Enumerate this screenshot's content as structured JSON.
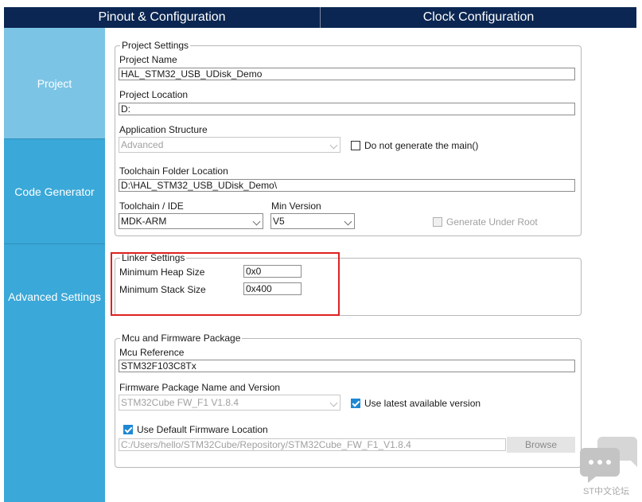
{
  "top_tabs": [
    "Pinout & Configuration",
    "Clock Configuration"
  ],
  "sidebar": {
    "items": [
      {
        "label": "Project",
        "active": true
      },
      {
        "label": "Code Generator",
        "active": false
      },
      {
        "label": "Advanced Settings",
        "active": false
      }
    ]
  },
  "project_settings": {
    "legend": "Project Settings",
    "project_name_label": "Project Name",
    "project_name_value": "HAL_STM32_USB_UDisk_Demo",
    "project_location_label": "Project Location",
    "project_location_value": "D:",
    "app_structure_label": "Application Structure",
    "app_structure_value": "Advanced",
    "no_main_label": "Do not generate the main()",
    "no_main_checked": false,
    "toolchain_folder_label": "Toolchain Folder Location",
    "toolchain_folder_value": "D:\\HAL_STM32_USB_UDisk_Demo\\",
    "toolchain_label": "Toolchain / IDE",
    "toolchain_value": "MDK-ARM",
    "min_version_label": "Min Version",
    "min_version_value": "V5",
    "gen_under_root_label": "Generate Under Root",
    "gen_under_root_checked": false
  },
  "linker_settings": {
    "legend": "Linker Settings",
    "heap_label": "Minimum Heap Size",
    "heap_value": "0x0",
    "stack_label": "Minimum Stack Size",
    "stack_value": "0x400"
  },
  "mcu_package": {
    "legend": "Mcu and Firmware Package",
    "mcu_ref_label": "Mcu Reference",
    "mcu_ref_value": "STM32F103C8Tx",
    "fw_pkg_label": "Firmware Package Name and Version",
    "fw_pkg_value": "STM32Cube FW_F1 V1.8.4",
    "use_latest_label": "Use latest available version",
    "use_latest_checked": true,
    "use_default_fw_label": "Use Default Firmware Location",
    "use_default_fw_checked": true,
    "fw_location_value": "C:/Users/hello/STM32Cube/Repository/STM32Cube_FW_F1_V1.8.4",
    "browse_label": "Browse"
  },
  "watermark": {
    "text": "ST中文论坛",
    "icon": "chat-bubble-icon"
  },
  "colors": {
    "topbar": "#0b2652",
    "sidebar": "#3aa8d8",
    "sidebar_active": "#7cc4e5",
    "checkbox_checked": "#1e88d4",
    "highlight": "#e02020"
  }
}
